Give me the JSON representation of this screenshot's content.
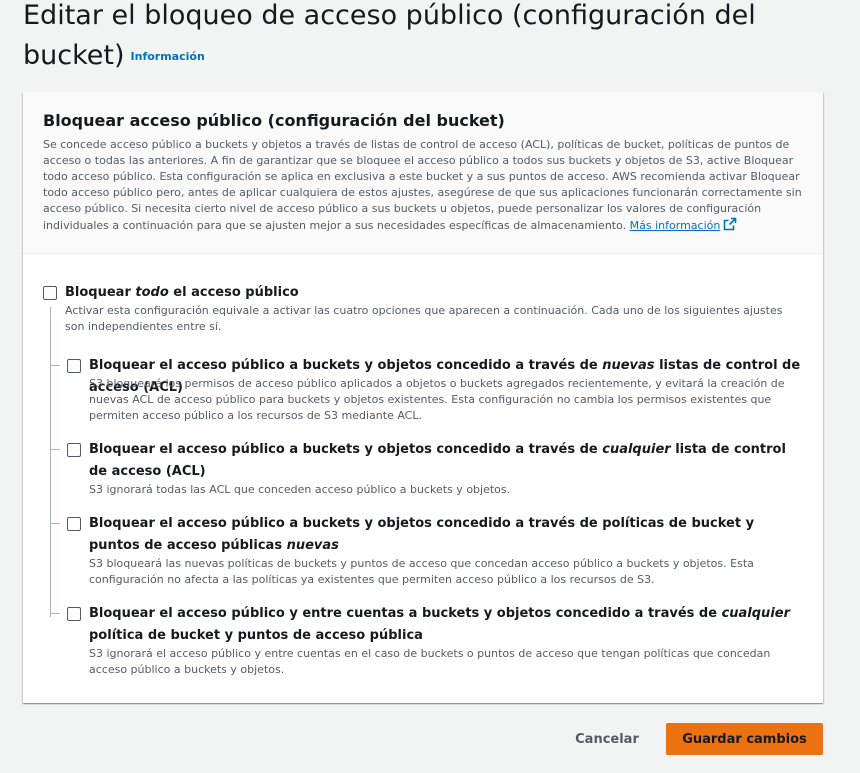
{
  "header": {
    "title": "Editar el bloqueo de acceso público (configuración del bucket)",
    "info_link": "Información"
  },
  "panel": {
    "title": "Bloquear acceso público (configuración del bucket)",
    "description": "Se concede acceso público a buckets y objetos a través de listas de control de acceso (ACL), políticas de bucket, políticas de puntos de acceso o todas las anteriores. A fin de garantizar que se bloquee el acceso público a todos sus buckets y objetos de S3, active Bloquear todo acceso público. Esta configuración se aplica en exclusiva a este bucket y a sus puntos de acceso. AWS recomienda activar Bloquear todo acceso público pero, antes de aplicar cualquiera de estos ajustes, asegúrese de que sus aplicaciones funcionarán correctamente sin acceso público. Si necesita cierto nivel de acceso público a sus buckets u objetos, puede personalizar los valores de configuración individuales a continuación para que se ajusten mejor a sus necesidades específicas de almacenamiento.",
    "more_info_link": "Más información"
  },
  "block_all": {
    "title_pre": "Bloquear ",
    "title_em": "todo",
    "title_post": " el acceso público",
    "description": "Activar esta configuración equivale a activar las cuatro opciones que aparecen a continuación. Cada uno de los siguientes ajustes son independientes entre sí.",
    "checked": false
  },
  "options": [
    {
      "title_pre": "Bloquear el acceso público a buckets y objetos concedido a través de ",
      "title_em": "nuevas",
      "title_post": " listas de control de acceso (ACL)",
      "description": "S3 bloqueará los permisos de acceso público aplicados a objetos o buckets agregados recientemente, y evitará la creación de nuevas ACL de acceso público para buckets y objetos existentes. Esta configuración no cambia los permisos existentes que permiten acceso público a los recursos de S3 mediante ACL.",
      "checked": false
    },
    {
      "title_pre": "Bloquear el acceso público a buckets y objetos concedido a través de ",
      "title_em": "cualquier",
      "title_post": " lista de control de acceso (ACL)",
      "description": "S3 ignorará todas las ACL que conceden acceso público a buckets y objetos.",
      "checked": false
    },
    {
      "title_pre": "Bloquear el acceso público a buckets y objetos concedido a través de políticas de bucket y puntos de acceso públicas ",
      "title_em": "nuevas",
      "title_post": "",
      "description": "S3 bloqueará las nuevas políticas de buckets y puntos de acceso que concedan acceso público a buckets y objetos. Esta configuración no afecta a las políticas ya existentes que permiten acceso público a los recursos de S3.",
      "checked": false
    },
    {
      "title_pre": "Bloquear el acceso público y entre cuentas a buckets y objetos concedido a través de ",
      "title_em": "cualquier",
      "title_post": " política de bucket y puntos de acceso pública",
      "description": "S3 ignorará el acceso público y entre cuentas en el caso de buckets o puntos de acceso que tengan políticas que concedan acceso público a buckets y objetos.",
      "checked": false
    }
  ],
  "footer": {
    "cancel_label": "Cancelar",
    "save_label": "Guardar cambios"
  },
  "colors": {
    "link": "#0073bb",
    "primary_button": "#ec7211",
    "page_background": "#f2f3f3"
  }
}
